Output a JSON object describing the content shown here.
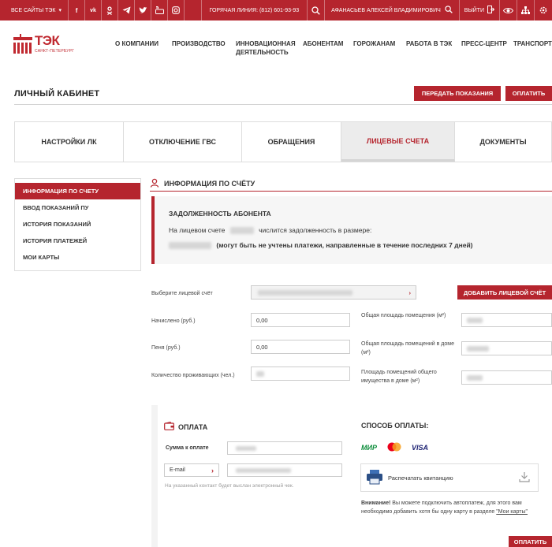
{
  "topbar": {
    "sites_label": "ВСЕ САЙТЫ ТЭК",
    "social": [
      "f",
      "vk",
      "ok",
      "tg",
      "tw",
      "yt",
      "ig"
    ],
    "hotline": "ГОРЯЧАЯ ЛИНИЯ: (812) 601-93-93",
    "user_name": "АФАНАСЬЕВ АЛЕКСЕЙ ВЛАДИМИРОВИЧ",
    "exit_label": "ВЫЙТИ"
  },
  "logo": {
    "brand": "ТЭК",
    "city": "САНКТ-ПЕТЕРБУРГ"
  },
  "nav": {
    "items": [
      "О КОМПАНИИ",
      "ПРОИЗВОДСТВО",
      "ИННОВАЦИОННАЯ",
      "ДЕЯТЕЛЬНОСТЬ",
      "АБОНЕНТАМ",
      "ГОРОЖАНАМ",
      "РАБОТА В ТЭК",
      "ПРЕСС-ЦЕНТР",
      "ТРАНСПОРТ"
    ]
  },
  "page": {
    "title": "ЛИЧНЫЙ КАБИНЕТ",
    "submit_readings": "ПЕРЕДАТЬ ПОКАЗАНИЯ",
    "pay": "ОПЛАТИТЬ"
  },
  "tabs": [
    "НАСТРОЙКИ ЛК",
    "ОТКЛЮЧЕНИЕ ГВС",
    "ОБРАЩЕНИЯ",
    "ЛИЦЕВЫЕ СЧЕТА",
    "ДОКУМЕНТЫ"
  ],
  "sidebar": {
    "items": [
      "ИНФОРМАЦИЯ ПО СЧЕТУ",
      "ВВОД ПОКАЗАНИЙ ПУ",
      "ИСТОРИЯ ПОКАЗАНИЙ",
      "ИСТОРИЯ ПЛАТЕЖЕЙ",
      "МОИ КАРТЫ"
    ]
  },
  "info": {
    "title": "ИНФОРМАЦИЯ ПО СЧЁТУ",
    "debt_title": "ЗАДОЛЖЕННОСТЬ АБОНЕНТА",
    "line1_a": "На лицевом счете",
    "line1_b": "числится задолженность в размере:",
    "line2": "(могут быть не учтены платежи, направленные в течение последних 7 дней)"
  },
  "form": {
    "account_label": "Выберите лицевой счёт",
    "add_account": "ДОБАВИТЬ ЛИЦЕВОЙ СЧЁТ",
    "accrued_label": "Начислено (руб.)",
    "accrued_value": "0,00",
    "penalty_label": "Пеня (руб.)",
    "penalty_value": "0,00",
    "residents_label": "Количество проживающих (чел.)",
    "area_label": "Общая площадь помещения (м²)",
    "house_area_label": "Общая площадь помещений в доме (м²)",
    "common_area_label": "Площадь помещений общего имущества в доме (м²)"
  },
  "payment": {
    "title": "ОПЛАТА",
    "sum_label": "Сумма к оплате",
    "email_label": "E-mail",
    "hint": "На указанный контакт будет выслан электронный чек.",
    "methods_title": "СПОСОБ ОПЛАТЫ:",
    "brands": [
      "МИР",
      "VISA"
    ],
    "print_label": "Распечатать квитанцию",
    "note_bold": "Внимание!",
    "note_text": " Вы можете подключить автоплатеж, для этого вам необходимо добавить хотя бы одну карту в разделе ",
    "note_link": "\"Мои карты\"",
    "pay_button": "ОПЛАТИТЬ"
  },
  "colors": {
    "accent": "#b5252e",
    "panel": "#f6f6f6"
  }
}
